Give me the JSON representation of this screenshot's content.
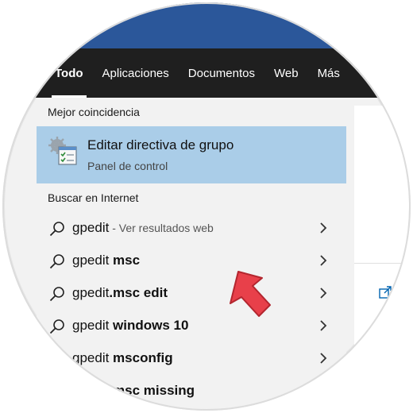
{
  "tabs": [
    "Todo",
    "Aplicaciones",
    "Documentos",
    "Web",
    "Más"
  ],
  "best_match": {
    "section_title": "Mejor coincidencia",
    "title": "Editar directiva de grupo",
    "subtitle": "Panel de control",
    "icon": "group-policy-icon"
  },
  "internet": {
    "section_title": "Buscar en Internet",
    "results": [
      {
        "prefix": "gpedit",
        "bold": "",
        "hint": " - Ver resultados web"
      },
      {
        "prefix": "gpedit ",
        "bold": "msc",
        "hint": ""
      },
      {
        "prefix": "gpedit",
        "bold": ".msc edit",
        "hint": ""
      },
      {
        "prefix": "gpedit ",
        "bold": "windows 10",
        "hint": ""
      },
      {
        "prefix": "gpedit ",
        "bold": "msconfig",
        "hint": ""
      },
      {
        "prefix": "gpedit ",
        "bold": "msc missing",
        "hint": ""
      }
    ]
  },
  "colors": {
    "top_band": "#2b579a",
    "tab_bar": "#1f1f1f",
    "selection": "#aacde8",
    "pointer": "#e8404a"
  }
}
